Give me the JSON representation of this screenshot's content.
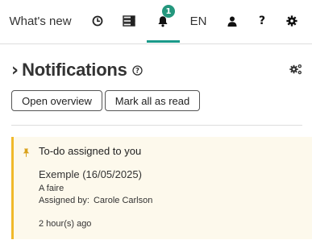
{
  "topbar": {
    "whats_new": "What's new",
    "notification_count": "1",
    "language": "EN",
    "icons": [
      "clock-icon",
      "list-icon",
      "bell-icon",
      "user-icon",
      "help-icon",
      "gear-icon"
    ]
  },
  "header": {
    "title": "Notifications"
  },
  "actions": {
    "open_overview": "Open overview",
    "mark_all_read": "Mark all as read"
  },
  "notifications": [
    {
      "title": "To-do assigned to you",
      "subject": "Exemple (16/05/2025)",
      "description": "A faire",
      "assigned_by_label": "Assigned by:",
      "assigned_by_name": "Carole Carlson",
      "time": "2 hour(s) ago"
    }
  ],
  "colors": {
    "accent": "#1b9a8a",
    "badge": "#24977d",
    "card_bg": "#fdf9ec",
    "card_border": "#f0b92b"
  }
}
